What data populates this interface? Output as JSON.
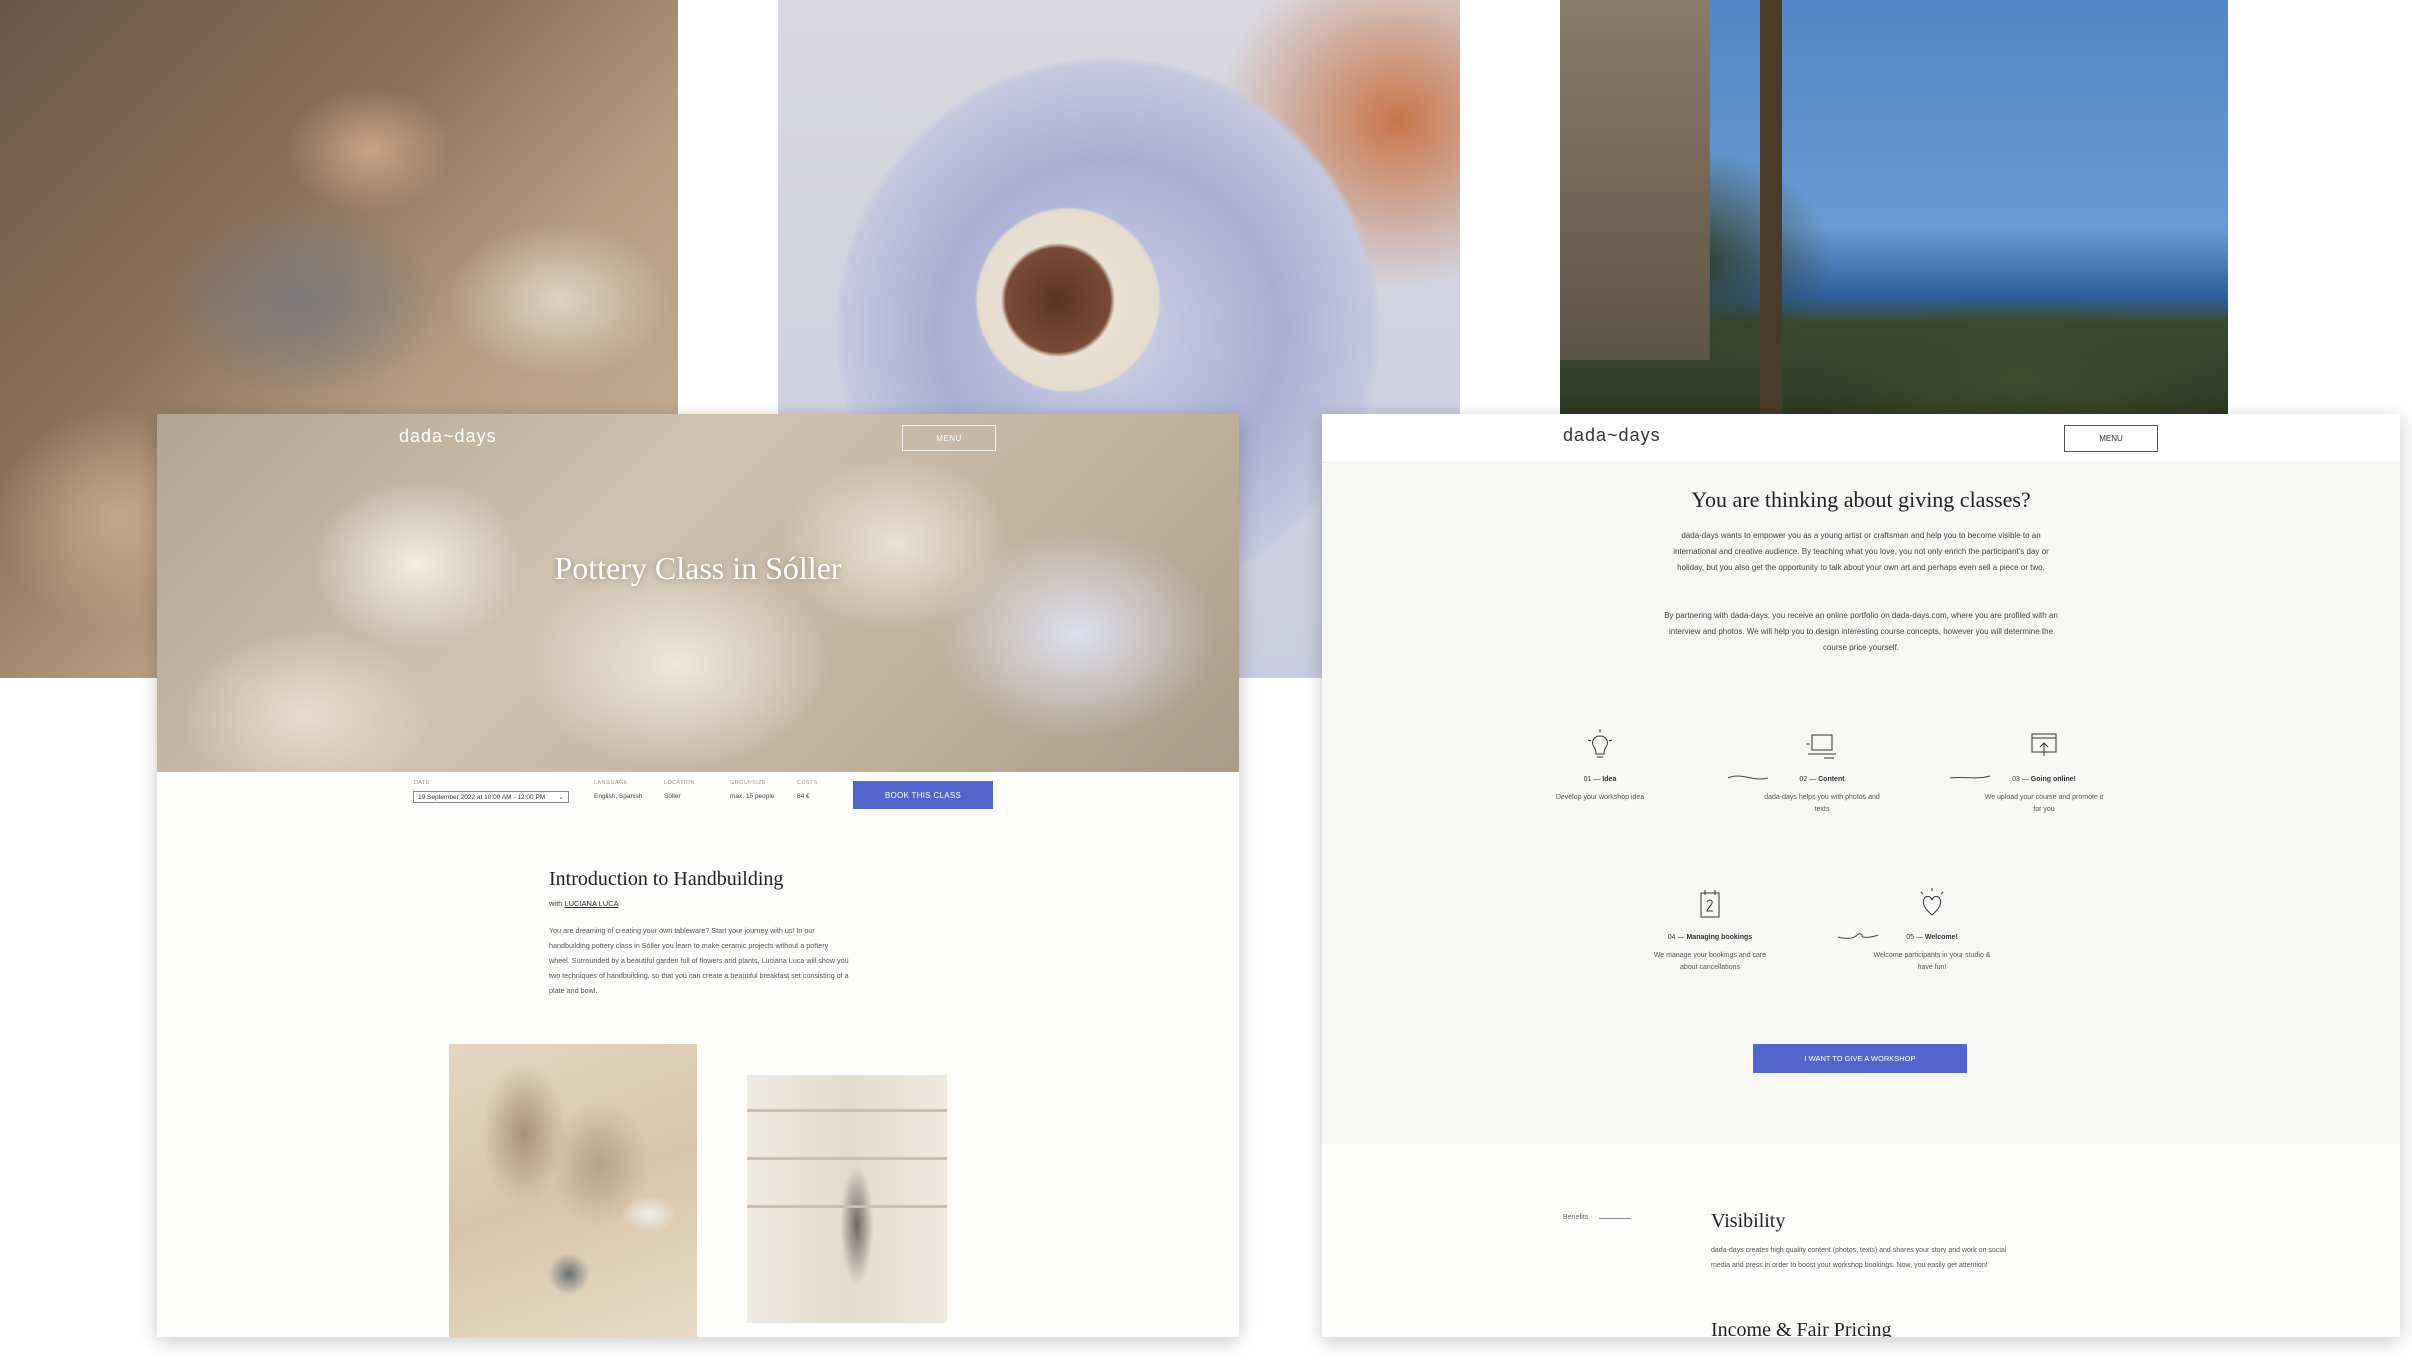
{
  "brand": {
    "logo": "dada~days",
    "accent": "#5364cc"
  },
  "class_page": {
    "menu_label": "MENU",
    "hero_title": "Pottery Class in Sóller",
    "booking": {
      "date_label": "DATE",
      "date_value": "19 September 2022 at 10:00 AM - 12:00 PM",
      "language_label": "LANGUAGE",
      "language_value": "English, Spanish",
      "location_label": "LOCATION",
      "location_value": "Sóller",
      "groupsize_label": "GROUPSIZE",
      "groupsize_value": "max. 15 people",
      "costs_label": "COSTS",
      "costs_value": "84 €",
      "book_button": "BOOK THIS CLASS"
    },
    "intro": {
      "heading": "Introduction to Handbuilding",
      "with_prefix": "with",
      "teacher": "LUCIANA LUCA",
      "text": "You are dreaming of creating your own tableware? Start your journey with us! In our handbuilding pottery class in Sóller you learn to make ceramic projects without a pottery wheel. Surrounded by a beautiful garden full of flowers and plants, Luciana Luca will show you two techniques of handbuilding, so that you can create a beautiful breakfast set consisting of a plate and bowl."
    }
  },
  "partner_page": {
    "menu_label": "MENU",
    "heading": "You are thinking about giving classes?",
    "para1": "dada-days wants to empower you as a young artist or craftsman and help you to become visible to an international and creative audience. By teaching what you love, you not only enrich the participant's day or holiday, but you also get the opportunity to talk about your own art and perhaps even sell a piece or two.",
    "para2": "By partnering with dada-days, you receive an online portfolio on dada-days.com, where you are profiled with an interview and photos. We will help you to design interesting course concepts, however you will determine the course price yourself.",
    "steps": [
      {
        "num": "01 —",
        "title": "Idea",
        "desc": "Develop your workshop idea",
        "icon": "lightbulb-icon"
      },
      {
        "num": "02 —",
        "title": "Content",
        "desc": "dada-days helps you with photos and texts",
        "icon": "computer-icon"
      },
      {
        "num": "03 —",
        "title": "Going online!",
        "desc": "We upload your course and promote it for you",
        "icon": "upload-icon"
      },
      {
        "num": "04 —",
        "title": "Managing bookings",
        "desc": "We manage your bookings and care about cancellations",
        "icon": "calendar-icon"
      },
      {
        "num": "05 —",
        "title": "Welcome!",
        "desc": "Welcome participants in your studio & have fun!",
        "icon": "heart-icon"
      }
    ],
    "cta_button": "I WANT TO GIVE A WORKSHOP",
    "benefits_label": "Benefits",
    "visibility_heading": "Visibility",
    "visibility_text": "dada-days creates high quality content (photos, texts) and shares your story and work on social media and press in order to boost your workshop bookings. Now, you easily get attention!",
    "pricing_heading": "Income & Fair Pricing"
  }
}
